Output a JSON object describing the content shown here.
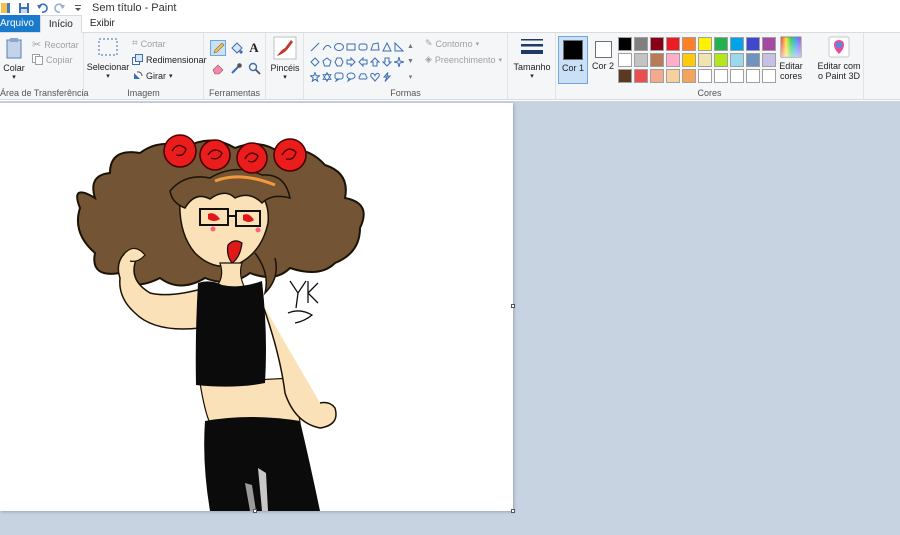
{
  "window": {
    "title": "Sem título - Paint"
  },
  "tabs": {
    "file": "Arquivo",
    "home": "Início",
    "view": "Exibir"
  },
  "clipboard": {
    "paste": "Colar",
    "cut": "Recortar",
    "copy": "Copiar",
    "group": "Área de Transferência"
  },
  "image": {
    "select": "Selecionar",
    "crop": "Cortar",
    "resize": "Redimensionar",
    "rotate": "Girar",
    "group": "Imagem"
  },
  "tools": {
    "group": "Ferramentas"
  },
  "brushes": {
    "label": "Pincéis"
  },
  "shapes": {
    "outline": "Contorno",
    "fill": "Preenchimento",
    "group": "Formas"
  },
  "size": {
    "label": "Tamanho"
  },
  "colors": {
    "color1": "Cor 1",
    "color2": "Cor 2",
    "group": "Cores",
    "edit": "Editar cores",
    "color1_value": "#000000",
    "color2_value": "#ffffff",
    "palette": [
      "#000000",
      "#7f7f7f",
      "#880015",
      "#ed1c24",
      "#ff7f27",
      "#fff200",
      "#22b14c",
      "#00a2e8",
      "#3f48cc",
      "#a349a4",
      "#ffffff",
      "#c3c3c3",
      "#b97a57",
      "#ffaec9",
      "#ffc90e",
      "#efe4b0",
      "#b5e61d",
      "#99d9ea",
      "#7092be",
      "#c8bfe7",
      "#59391f",
      "#ea4f4f",
      "#f3a98c",
      "#f7d0a0",
      "#f4a35a",
      "#ffffff",
      "#ffffff",
      "#ffffff",
      "#ffffff",
      "#ffffff"
    ]
  },
  "paint3d": {
    "label": "Editar com o Paint 3D"
  },
  "canvas": {
    "signature": "YK"
  }
}
